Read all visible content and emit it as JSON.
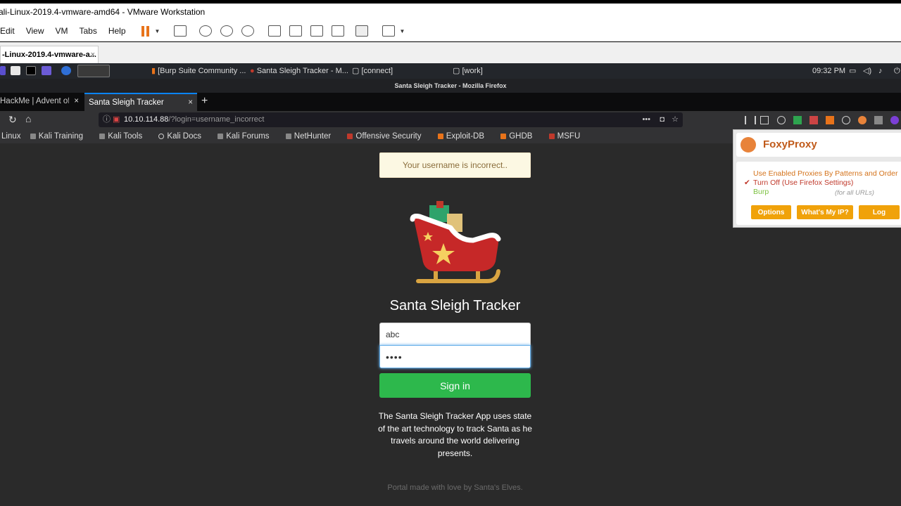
{
  "vmware": {
    "title": "ali-Linux-2019.4-vmware-amd64 - VMware Workstation",
    "menu": [
      "Edit",
      "View",
      "VM",
      "Tabs",
      "Help"
    ],
    "tab_label": "-Linux-2019.4-vmware-a...",
    "tab_close": "×"
  },
  "kali_panel": {
    "tasks": [
      "[Burp Suite Community ...",
      "Santa Sleigh Tracker - M...",
      "[connect]",
      "[work]"
    ],
    "time": "09:32 PM"
  },
  "firefox": {
    "window_title": "Santa Sleigh Tracker - Mozilla Firefox",
    "tabs": [
      {
        "label": "HackMe | Advent of C"
      },
      {
        "label": "Santa Sleigh Tracker"
      }
    ],
    "tab_close": "×",
    "new_tab": "+",
    "url_host": "10.10.114.88",
    "url_path": "/?login=username_incorrect",
    "bookmarks": [
      "Linux",
      "Kali Training",
      "Kali Tools",
      "Kali Docs",
      "Kali Forums",
      "NetHunter",
      "Offensive Security",
      "Exploit-DB",
      "GHDB",
      "MSFU"
    ]
  },
  "page": {
    "alert": "Your username is incorrect..",
    "title": "Santa Sleigh Tracker",
    "username_value": "abc",
    "password_value": "••••",
    "signin_label": "Sign in",
    "description": "The Santa Sleigh Tracker App uses state of the art technology to track Santa as he travels around the world delivering presents.",
    "footer": "Portal made with love by Santa's Elves."
  },
  "foxyproxy": {
    "name": "FoxyProxy",
    "option_patterns": "Use Enabled Proxies By Patterns and Order",
    "option_off": "Turn Off (Use Firefox Settings)",
    "checkmark": "✔",
    "proxy_name": "Burp",
    "proxy_scope": "(for all URLs)",
    "buttons": [
      "Options",
      "What's My IP?",
      "Log"
    ]
  },
  "colors": {
    "signin": "#2db84c",
    "foxy_orange": "#f0a20a",
    "tab_accent": "#0a84ff"
  },
  "icons": [
    "pause-icon",
    "snapshot-icon",
    "fullscreen-icon",
    "reload-icon",
    "home-icon",
    "info-icon",
    "bookmark-star-icon",
    "pocket-icon",
    "library-icon",
    "sidebar-icon",
    "account-icon",
    "foxyproxy-icon",
    "notification-bell-icon",
    "volume-icon"
  ]
}
